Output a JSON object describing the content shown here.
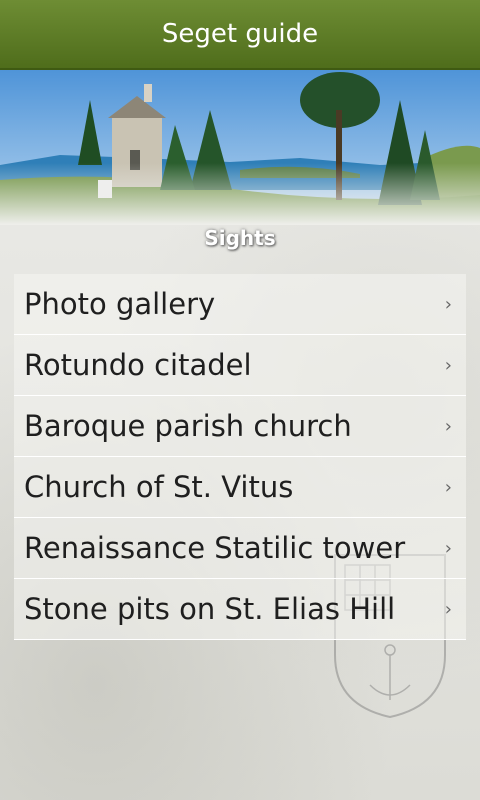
{
  "app": {
    "title": "Seget guide"
  },
  "section": {
    "title": "Sights"
  },
  "items": [
    {
      "label": "Photo gallery"
    },
    {
      "label": "Rotundo citadel"
    },
    {
      "label": "Baroque parish church"
    },
    {
      "label": "Church of St. Vitus"
    },
    {
      "label": "Renaissance Statilic tower"
    },
    {
      "label": "Stone pits on St. Elias Hill"
    }
  ],
  "colors": {
    "titlebar": "#5d7b26",
    "text": "#1f1f1f"
  }
}
